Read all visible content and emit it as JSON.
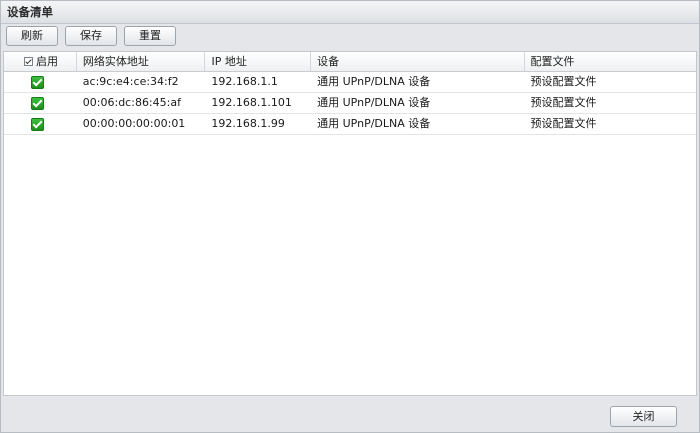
{
  "window": {
    "title": "设备清单"
  },
  "toolbar": {
    "refresh_label": "刷新",
    "save_label": "保存",
    "reset_label": "重置"
  },
  "table": {
    "columns": [
      "启用",
      "网络实体地址",
      "IP 地址",
      "设备",
      "配置文件"
    ],
    "rows": [
      {
        "enabled": true,
        "mac": "ac:9c:e4:ce:34:f2",
        "ip": "192.168.1.1",
        "device": "通用 UPnP/DLNA 设备",
        "profile": "预设配置文件"
      },
      {
        "enabled": true,
        "mac": "00:06:dc:86:45:af",
        "ip": "192.168.1.101",
        "device": "通用 UPnP/DLNA 设备",
        "profile": "预设配置文件"
      },
      {
        "enabled": true,
        "mac": "00:00:00:00:00:01",
        "ip": "192.168.1.99",
        "device": "通用 UPnP/DLNA 设备",
        "profile": "预设配置文件"
      }
    ]
  },
  "footer": {
    "close_label": "关闭"
  },
  "colors": {
    "check_green": "#2aa62a",
    "window_bg": "#e4e6ea",
    "grid_bg": "#ffffff"
  },
  "icons": {
    "header_checkbox": "checkbox-checked-icon",
    "row_checkbox": "green-check-icon"
  }
}
